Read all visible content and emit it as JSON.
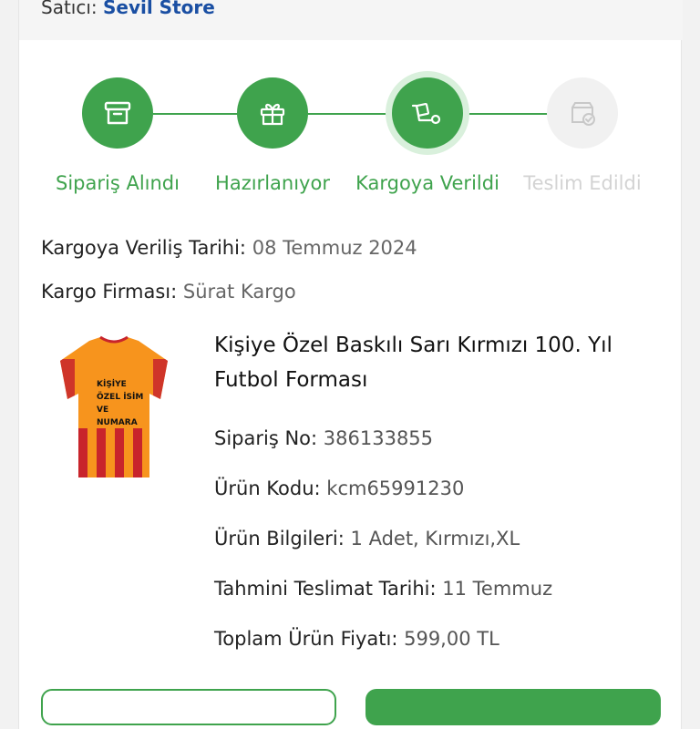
{
  "seller": {
    "label": "Satıcı:",
    "store": "Sevil Store"
  },
  "steps": [
    {
      "label": "Sipariş Alındı",
      "icon": "archive-box-icon",
      "state": "done"
    },
    {
      "label": "Hazırlanıyor",
      "icon": "gift-box-icon",
      "state": "done"
    },
    {
      "label": "Kargoya Verildi",
      "icon": "delivery-dolly-icon",
      "state": "current"
    },
    {
      "label": "Teslim Edildi",
      "icon": "delivered-package-check-icon",
      "state": "pending"
    }
  ],
  "shipping": {
    "date_label": "Kargoya Veriliş Tarihi:",
    "date_value": "08 Temmuz 2024",
    "company_label": "Kargo Firması:",
    "company_value": "Sürat Kargo"
  },
  "product": {
    "title": "Kişiye Özel Baskılı Sarı Kırmızı 100. Yıl Futbol Forması",
    "image_text": [
      "KİŞİYE",
      "ÖZEL İSİM",
      "VE",
      "NUMARA"
    ],
    "details": [
      {
        "label": "Sipariş No:",
        "value": "386133855"
      },
      {
        "label": "Ürün Kodu:",
        "value": "kcm65991230"
      },
      {
        "label": "Ürün Bilgileri:",
        "value": "1 Adet, Kırmızı,XL"
      },
      {
        "label": "Tahmini Teslimat Tarihi:",
        "value": "11 Temmuz"
      },
      {
        "label": "Toplam Ürün Fiyatı:",
        "value": "599,00 TL"
      }
    ]
  },
  "colors": {
    "accent": "#3fa34d",
    "accent_light": "#d9f0dc",
    "pending": "#f1f1f1",
    "link": "#1a4fa3"
  }
}
